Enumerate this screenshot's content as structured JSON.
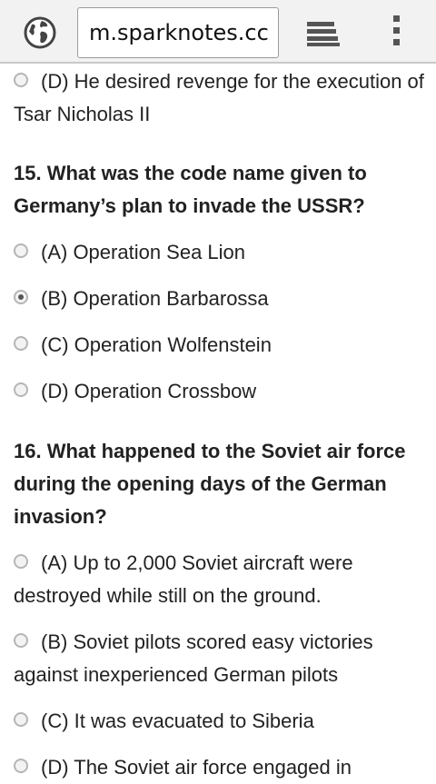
{
  "browser": {
    "url": "m.sparknotes.cc",
    "icons": {
      "site": "globe-icon",
      "tabs": "tabs-icon",
      "menu": "overflow-menu-icon"
    }
  },
  "quiz": {
    "prev_option_d": "(D) He desired revenge for the execution of Tsar Nicholas II",
    "q15": {
      "question": "15. What was the code name given to Germany’s plan to invade the USSR?",
      "options": [
        "(A) Operation Sea Lion",
        "(B) Operation Barbarossa",
        "(C) Operation Wolfenstein",
        "(D) Operation Crossbow"
      ],
      "selected": "(B) Operation Barbarossa"
    },
    "q16": {
      "question": "16. What happened to the Soviet air force during the opening days of the German invasion?",
      "options": [
        "(A) Up to 2,000 Soviet aircraft were destroyed while still on the ground.",
        "(B) Soviet pilots scored easy victories against inexperienced German pilots",
        "(C) It was evacuated to Siberia",
        "(D) The Soviet air force engaged in"
      ]
    }
  }
}
